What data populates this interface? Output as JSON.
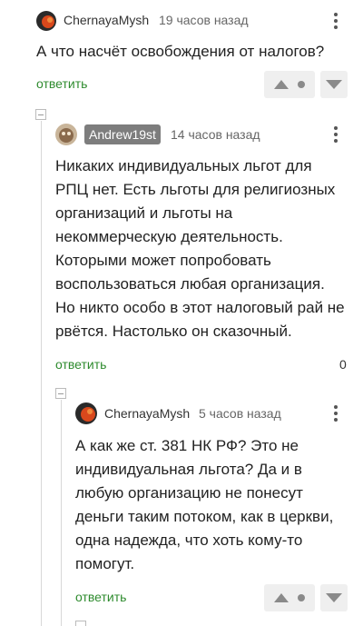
{
  "comments": [
    {
      "author": "ChernayaMysh",
      "time": "19 часов назад",
      "text": "А что насчёт освобождения от налогов?",
      "reply_label": "ответить"
    },
    {
      "author": "Andrew19st",
      "time": "14 часов назад",
      "text": "Никаких индивидуальных льгот для РПЦ нет. Есть льготы для религиозных организаций и льготы на некоммерческую деятельность. Которыми может попробовать воспользоваться любая организация. Но никто особо в этот налоговый рай не рвётся. Настолько он сказочный.",
      "reply_label": "ответить",
      "score": "0"
    },
    {
      "author": "ChernayaMysh",
      "time": "5 часов назад",
      "text": "А как же ст. 381 НК РФ? Это не индивидуальная льгота? Да и в любую организацию не понесут деньги таким потоком, как в церкви, одна надежда, что хоть кому-то помогут.",
      "reply_label": "ответить"
    }
  ],
  "colors": {
    "reply_link": "#2e8b2e",
    "vote_bg": "#efefef",
    "badge_bg": "#7d7d7d"
  },
  "icons": {
    "upvote": "triangle-up-icon",
    "downvote": "triangle-down-icon",
    "more": "kebab-icon",
    "collapse": "minus-box-icon"
  }
}
